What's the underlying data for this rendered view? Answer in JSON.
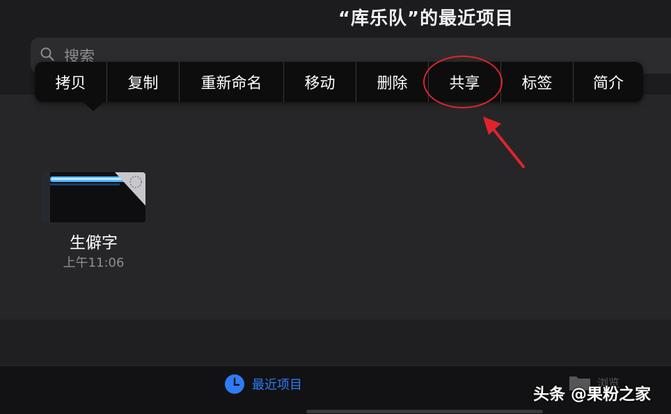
{
  "header": {
    "title": "“库乐队”的最近项目"
  },
  "search": {
    "placeholder": "搜索"
  },
  "context_menu": {
    "items": [
      "拷贝",
      "复制",
      "重新命名",
      "移动",
      "删除",
      "共享",
      "标签",
      "简介"
    ],
    "highlighted_item": "共享",
    "highlight_color": "#e0242b"
  },
  "file": {
    "name": "生僻字",
    "time": "上午11:06"
  },
  "tab_bar": {
    "recent_label": "最近项目",
    "browse_label": "浏览",
    "accent_color": "#2f7bf6"
  },
  "watermark": {
    "text": "头条 @果粉之家"
  }
}
